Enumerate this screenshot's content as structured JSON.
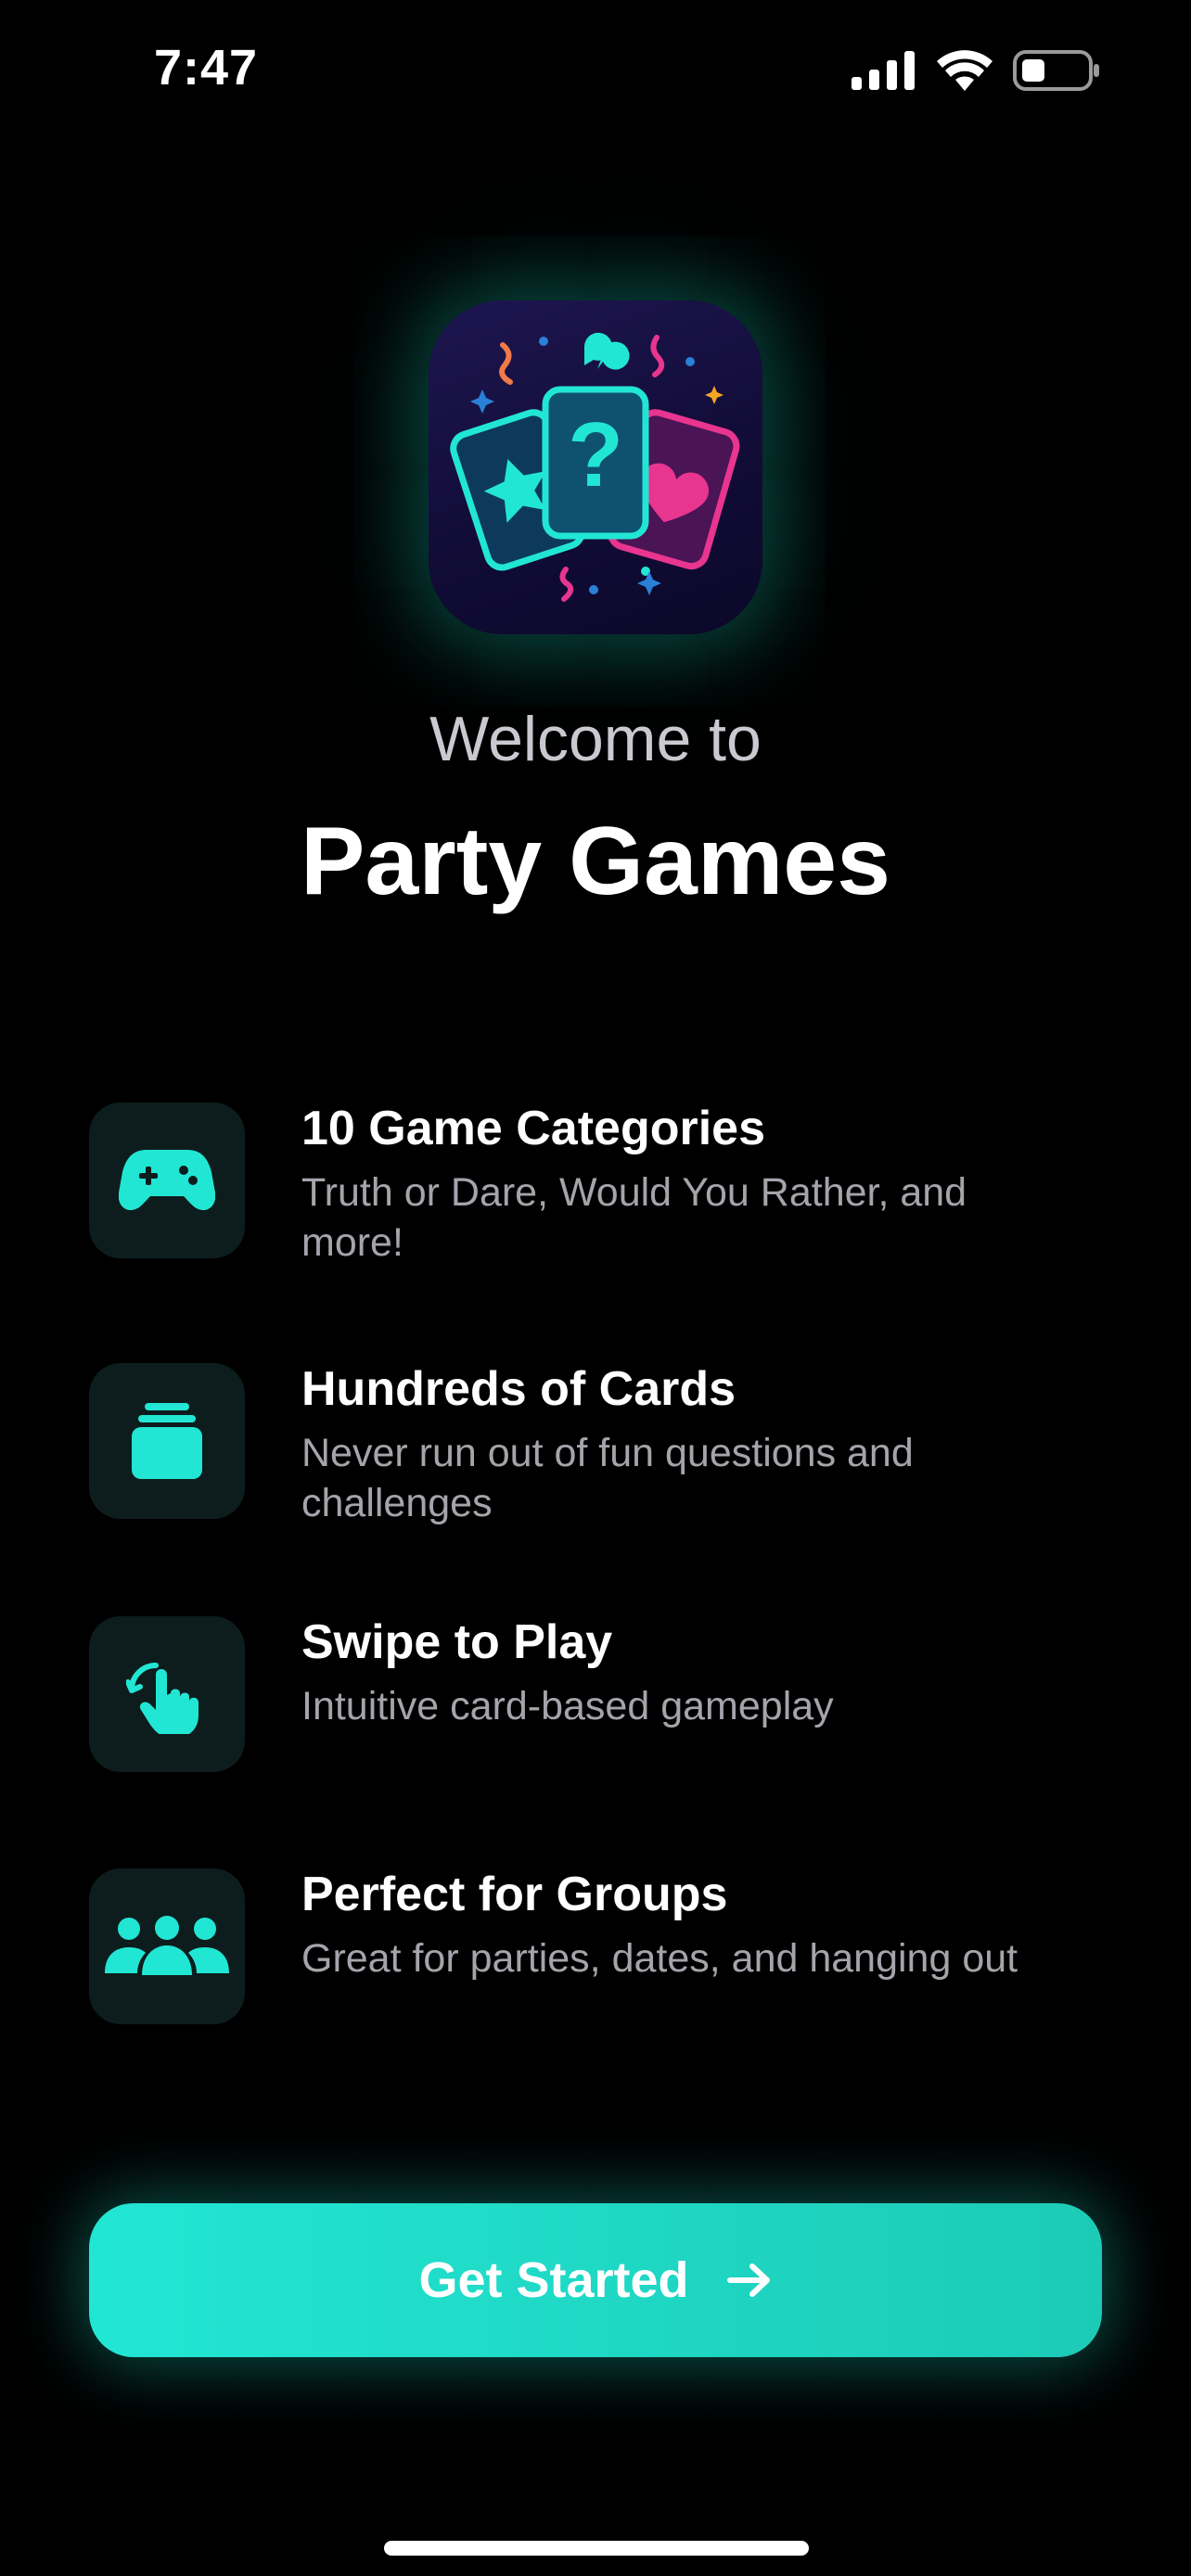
{
  "status_bar": {
    "time": "7:47",
    "icons": [
      "cellular-signal-icon",
      "wifi-icon",
      "battery-icon"
    ]
  },
  "app_icon": {
    "name": "party-games-app-icon"
  },
  "welcome": {
    "greeting": "Welcome to",
    "app_name": "Party Games"
  },
  "features": [
    {
      "icon": "gamepad-icon",
      "title": "10 Game Categories",
      "description": "Truth or Dare, Would You Rather, and more!"
    },
    {
      "icon": "card-stack-icon",
      "title": "Hundreds of Cards",
      "description": "Never run out of fun questions and challenges"
    },
    {
      "icon": "swipe-hand-icon",
      "title": "Swipe to Play",
      "description": "Intuitive card-based gameplay"
    },
    {
      "icon": "group-people-icon",
      "title": "Perfect for Groups",
      "description": "Great for parties, dates, and hanging out"
    }
  ],
  "cta": {
    "label": "Get Started",
    "icon": "arrow-right-icon"
  },
  "colors": {
    "background": "#000000",
    "accent": "#1FE3CE",
    "icon_tile": "#0D1D1D",
    "secondary_text": "#A4A4AB",
    "pink": "#E8358F"
  }
}
